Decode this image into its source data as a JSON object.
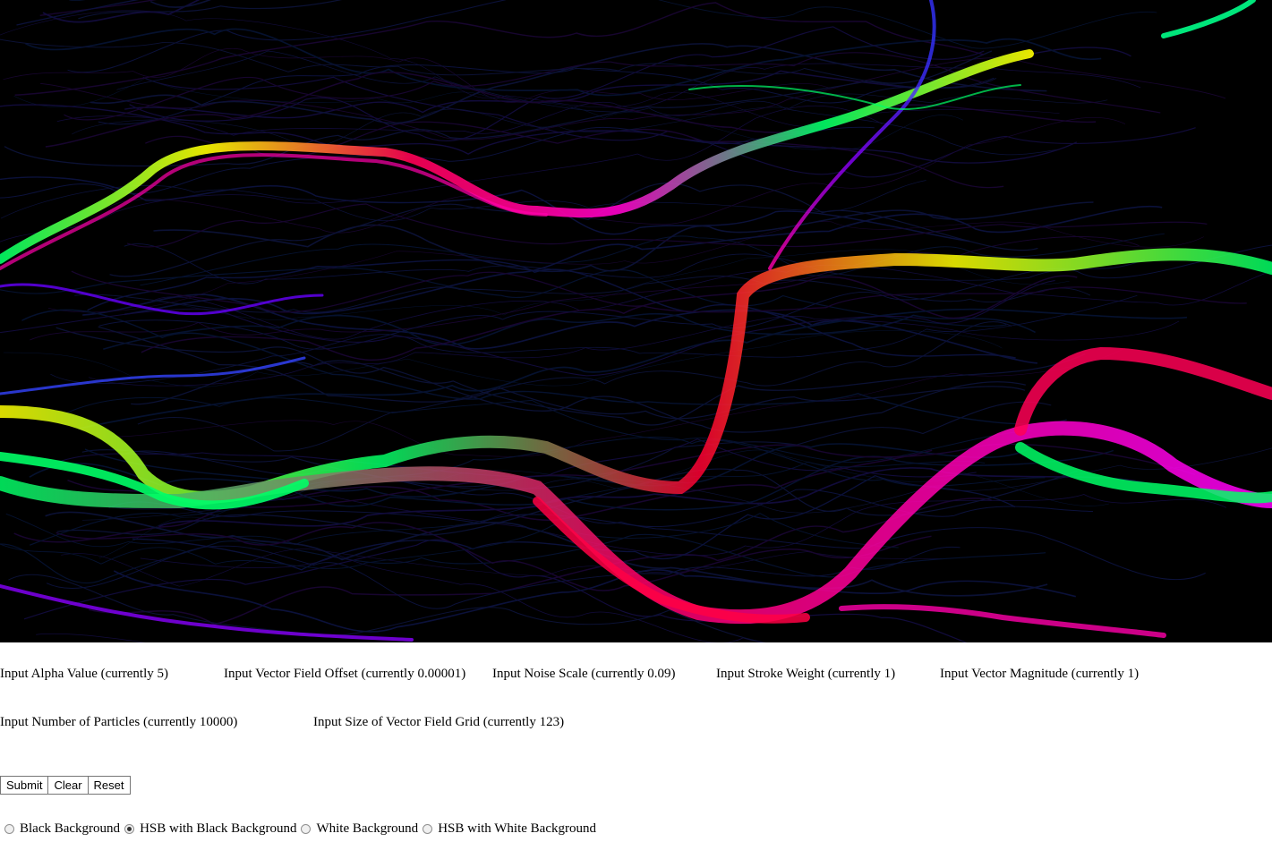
{
  "canvas": {
    "name": "flow-field-canvas",
    "background": "#000000",
    "stream_colors": [
      "#ff0000",
      "#ff00aa",
      "#ffff00",
      "#00ff66",
      "#3333ff",
      "#8800ff",
      "#ff8800"
    ]
  },
  "inputs": [
    {
      "key": "alpha",
      "label": "Input Alpha Value (currently 5)"
    },
    {
      "key": "offset",
      "label": "Input Vector Field Offset (currently 0.00001)"
    },
    {
      "key": "noise",
      "label": "Input Noise Scale (currently 0.09)"
    },
    {
      "key": "stroke",
      "label": "Input Stroke Weight (currently 1)"
    },
    {
      "key": "magnitude",
      "label": "Input Vector Magnitude (currently 1)"
    },
    {
      "key": "particles",
      "label": "Input Number of Particles (currently 10000)"
    },
    {
      "key": "grid",
      "label": "Input Size of Vector Field Grid (currently 123)"
    }
  ],
  "buttons": {
    "submit": "Submit",
    "clear": "Clear",
    "reset": "Reset"
  },
  "background_options": [
    {
      "label": "Black Background",
      "checked": false
    },
    {
      "label": "HSB with Black Background",
      "checked": true
    },
    {
      "label": "White Background",
      "checked": false
    },
    {
      "label": "HSB with White Background",
      "checked": false
    }
  ]
}
